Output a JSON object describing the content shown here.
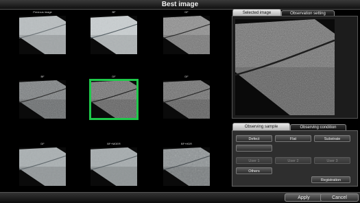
{
  "window": {
    "title": "Best image"
  },
  "grid": {
    "cells": [
      {
        "label": "Previous image",
        "tone": "#b9bec0",
        "crack": "#6d7478",
        "texture": "smooth"
      },
      {
        "label": "BF",
        "tone": "#c9ced0",
        "crack": "#566066",
        "texture": "smooth"
      },
      {
        "label": "DF",
        "tone": "#8a8a8a",
        "crack": "#2a2a2a",
        "texture": "rough"
      },
      {
        "label": "BF",
        "tone": "#767a7c",
        "crack": "#2e2e2e",
        "texture": "rough"
      },
      {
        "label": "DF",
        "tone": "#6e6e6e",
        "crack": "#1e1e1e",
        "texture": "rough",
        "selected": true
      },
      {
        "label": "DF",
        "tone": "#6a6a6a",
        "crack": "#262626",
        "texture": "rough"
      },
      {
        "label": "DF",
        "tone": "#aab0b2",
        "crack": "#60686c",
        "texture": "smooth"
      },
      {
        "label": "BF+MOER",
        "tone": "#a6acae",
        "crack": "#5b6367",
        "texture": "smooth"
      },
      {
        "label": "BF+HDR",
        "tone": "#8f9496",
        "crack": "#4a5054",
        "texture": "medium"
      }
    ]
  },
  "tabs": {
    "selected_image": "Selected image",
    "observation_setting": "Observation setting"
  },
  "sample": {
    "tab_sample": "Observing sample",
    "tab_condition": "Observing condition",
    "defect": "Defect",
    "flat": "Flat",
    "substrate": "Substrate",
    "user1": "User 1",
    "user2": "User 2",
    "user3": "User 3",
    "others": "Others",
    "registration": "Registration"
  },
  "footer": {
    "apply": "Apply",
    "cancel": "Cancel"
  }
}
